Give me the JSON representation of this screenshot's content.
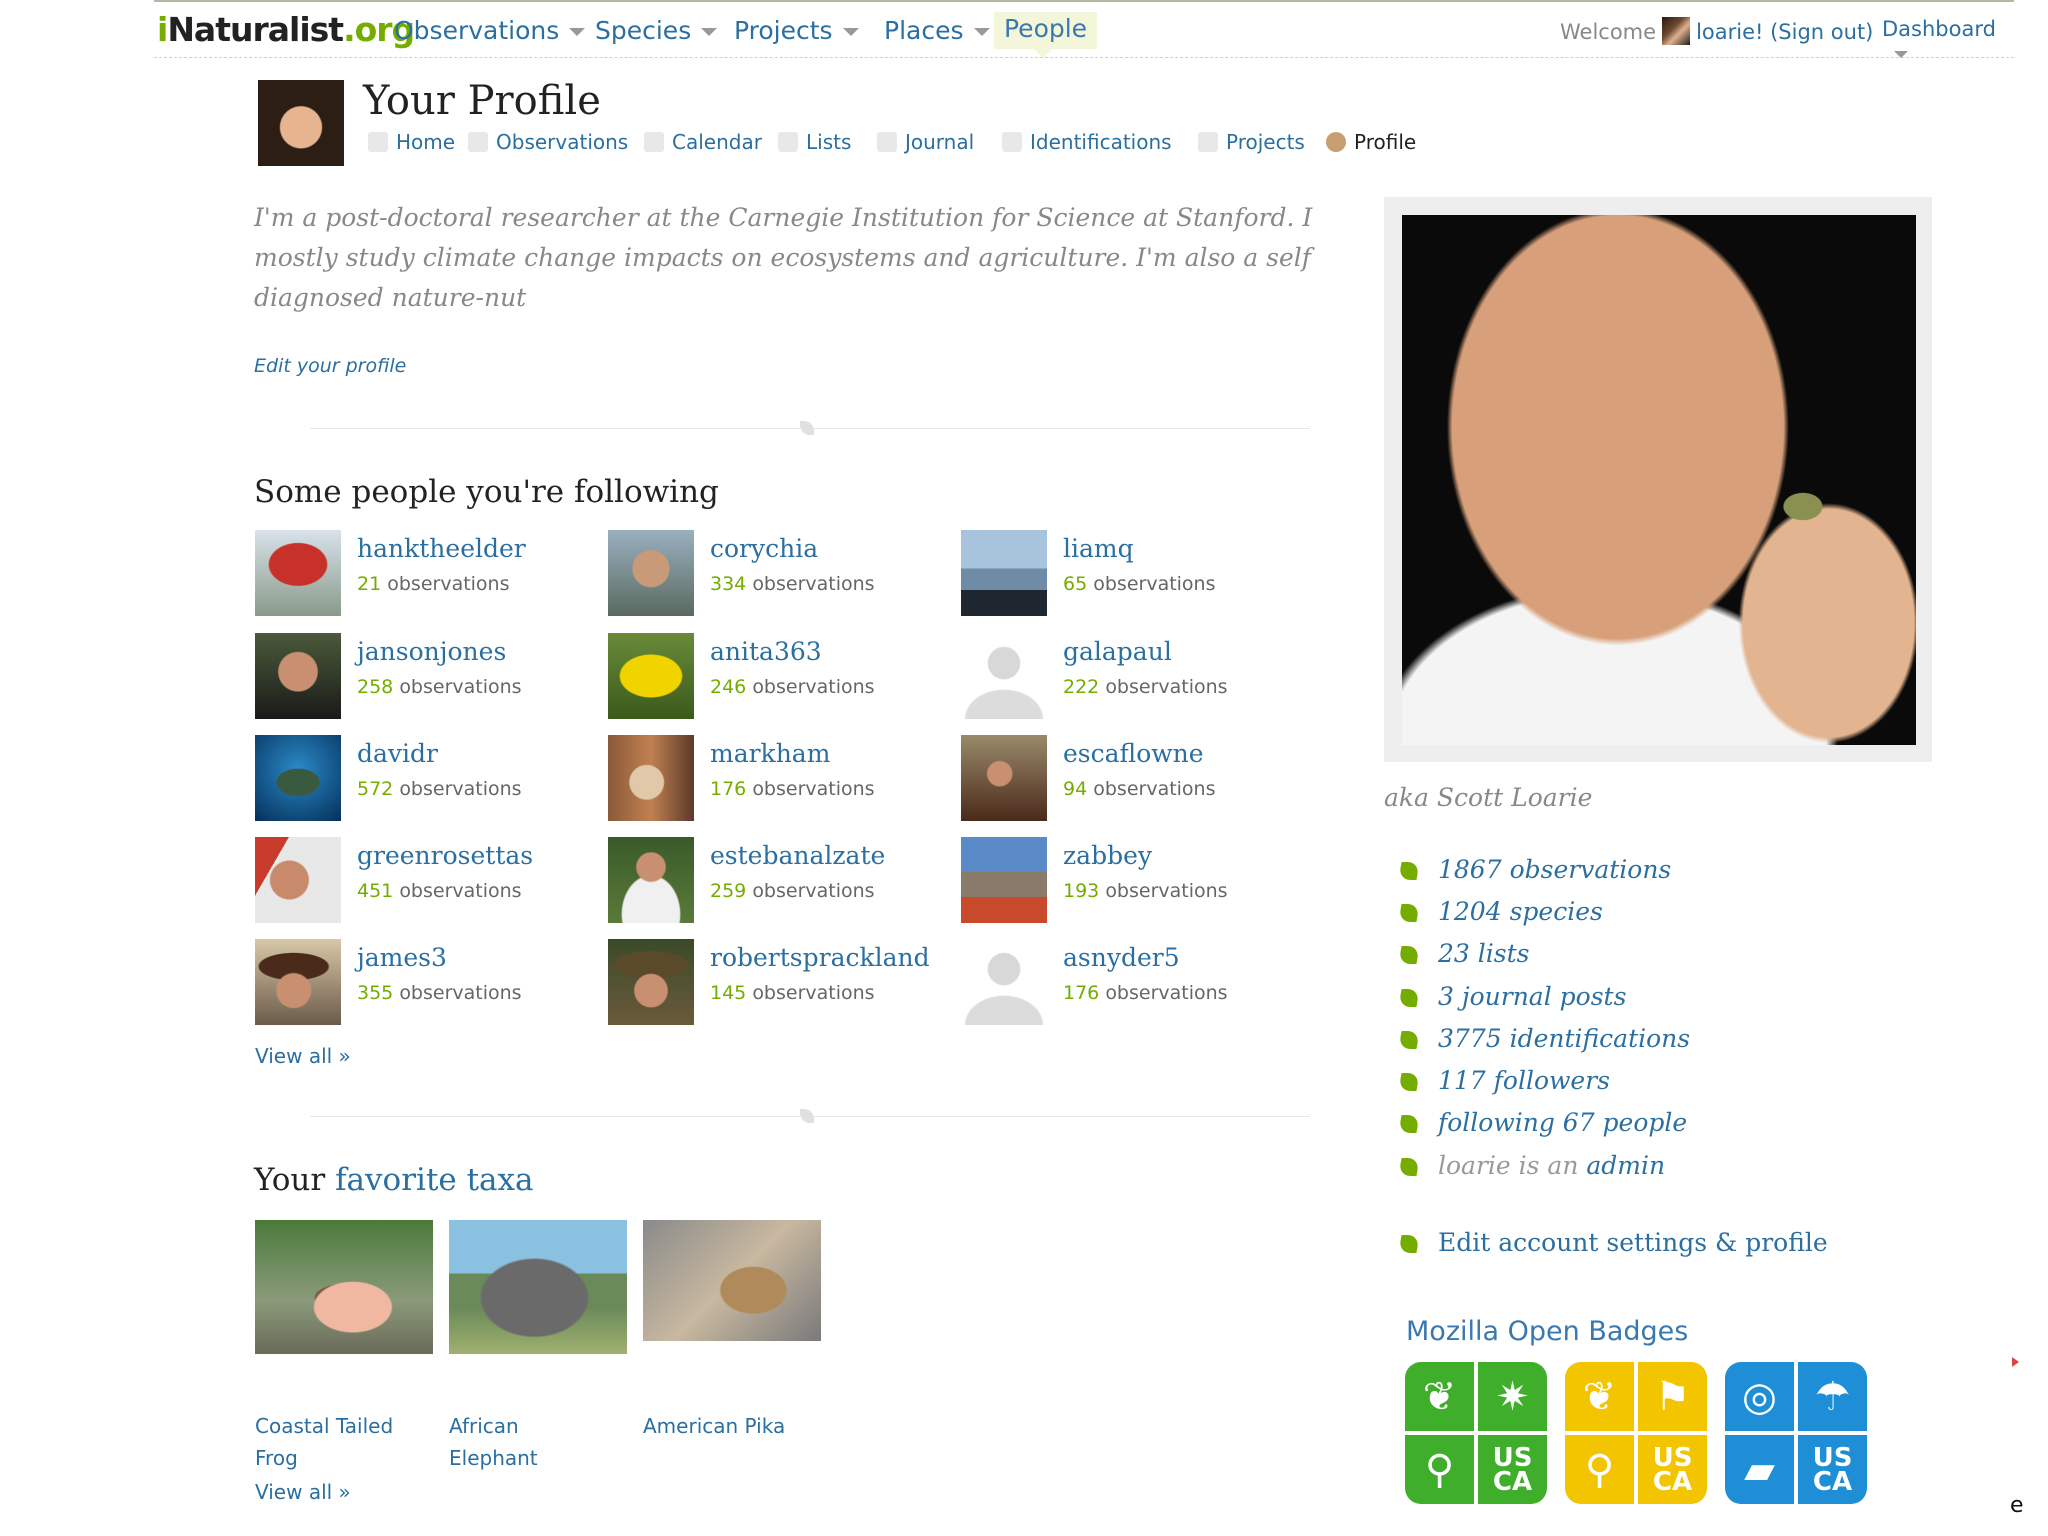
{
  "nav": {
    "logo_prefix": "i",
    "logo_main": "Naturalist",
    "logo_suffix": ".org",
    "items": [
      "Observations",
      "Species",
      "Projects",
      "Places",
      "People"
    ],
    "welcome_prefix": "Welcome",
    "username": "loarie!",
    "sign_out": "(Sign out)",
    "dashboard": "Dashboard"
  },
  "profile": {
    "title": "Your Profile",
    "tabs": [
      "Home",
      "Observations",
      "Calendar",
      "Lists",
      "Journal",
      "Identifications",
      "Projects",
      "Profile"
    ],
    "bio": "I'm a post-doctoral researcher at the Carnegie Institution for Science at Stanford. I mostly study climate change impacts on ecosystems and agriculture. I'm also a self diagnosed nature-nut",
    "edit_profile": "Edit your profile"
  },
  "following": {
    "title": "Some people you're following",
    "observations_label": "observations",
    "people": [
      {
        "name": "hanktheelder",
        "count": "21"
      },
      {
        "name": "corychia",
        "count": "334"
      },
      {
        "name": "liamq",
        "count": "65"
      },
      {
        "name": "jansonjones",
        "count": "258"
      },
      {
        "name": "anita363",
        "count": "246"
      },
      {
        "name": "galapaul",
        "count": "222"
      },
      {
        "name": "davidr",
        "count": "572"
      },
      {
        "name": "markham",
        "count": "176"
      },
      {
        "name": "escaflowne",
        "count": "94"
      },
      {
        "name": "greenrosettas",
        "count": "451"
      },
      {
        "name": "estebanalzate",
        "count": "259"
      },
      {
        "name": "zabbey",
        "count": "193"
      },
      {
        "name": "james3",
        "count": "355"
      },
      {
        "name": "robertsprackland",
        "count": "145"
      },
      {
        "name": "asnyder5",
        "count": "176"
      }
    ],
    "view_all": "View all »"
  },
  "taxa": {
    "title_prefix": "Your",
    "title_link": "favorite taxa",
    "items": [
      "Coastal Tailed Frog",
      "African Elephant",
      "American Pika"
    ],
    "view_all": "View all »"
  },
  "sidebar": {
    "aka": "aka Scott Loarie",
    "stats": [
      "1867 observations",
      "1204 species",
      "23 lists",
      "3 journal posts",
      "3775 identifications",
      "117 followers",
      "following 67 people"
    ],
    "admin_prefix": "loarie is an",
    "admin_link": "admin",
    "edit_account": "Edit account settings & profile",
    "badges_title": "Mozilla Open Badges",
    "badge_text": "US CA"
  },
  "colors": {
    "link": "#2b6fa0",
    "accent_green": "#74ac00",
    "badge_green": "#3fae2a",
    "badge_yellow": "#f2c500",
    "badge_blue": "#1e8ed6"
  },
  "corner_char": "e"
}
